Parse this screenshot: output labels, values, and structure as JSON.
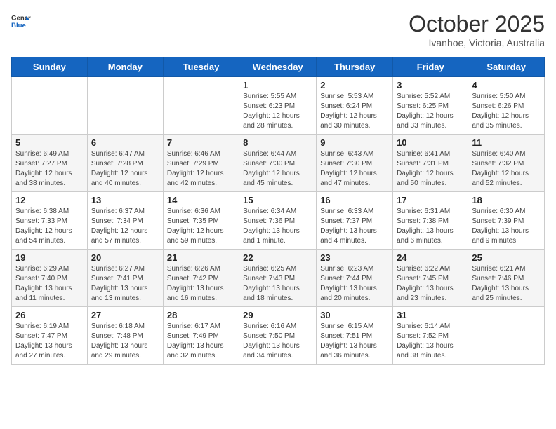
{
  "header": {
    "logo": {
      "general": "General",
      "blue": "Blue"
    },
    "title": "October 2025",
    "location": "Ivanhoe, Victoria, Australia"
  },
  "weekdays": [
    "Sunday",
    "Monday",
    "Tuesday",
    "Wednesday",
    "Thursday",
    "Friday",
    "Saturday"
  ],
  "weeks": [
    [
      {
        "day": "",
        "sunrise": "",
        "sunset": "",
        "daylight": ""
      },
      {
        "day": "",
        "sunrise": "",
        "sunset": "",
        "daylight": ""
      },
      {
        "day": "",
        "sunrise": "",
        "sunset": "",
        "daylight": ""
      },
      {
        "day": "1",
        "sunrise": "Sunrise: 5:55 AM",
        "sunset": "Sunset: 6:23 PM",
        "daylight": "Daylight: 12 hours and 28 minutes."
      },
      {
        "day": "2",
        "sunrise": "Sunrise: 5:53 AM",
        "sunset": "Sunset: 6:24 PM",
        "daylight": "Daylight: 12 hours and 30 minutes."
      },
      {
        "day": "3",
        "sunrise": "Sunrise: 5:52 AM",
        "sunset": "Sunset: 6:25 PM",
        "daylight": "Daylight: 12 hours and 33 minutes."
      },
      {
        "day": "4",
        "sunrise": "Sunrise: 5:50 AM",
        "sunset": "Sunset: 6:26 PM",
        "daylight": "Daylight: 12 hours and 35 minutes."
      }
    ],
    [
      {
        "day": "5",
        "sunrise": "Sunrise: 6:49 AM",
        "sunset": "Sunset: 7:27 PM",
        "daylight": "Daylight: 12 hours and 38 minutes."
      },
      {
        "day": "6",
        "sunrise": "Sunrise: 6:47 AM",
        "sunset": "Sunset: 7:28 PM",
        "daylight": "Daylight: 12 hours and 40 minutes."
      },
      {
        "day": "7",
        "sunrise": "Sunrise: 6:46 AM",
        "sunset": "Sunset: 7:29 PM",
        "daylight": "Daylight: 12 hours and 42 minutes."
      },
      {
        "day": "8",
        "sunrise": "Sunrise: 6:44 AM",
        "sunset": "Sunset: 7:30 PM",
        "daylight": "Daylight: 12 hours and 45 minutes."
      },
      {
        "day": "9",
        "sunrise": "Sunrise: 6:43 AM",
        "sunset": "Sunset: 7:30 PM",
        "daylight": "Daylight: 12 hours and 47 minutes."
      },
      {
        "day": "10",
        "sunrise": "Sunrise: 6:41 AM",
        "sunset": "Sunset: 7:31 PM",
        "daylight": "Daylight: 12 hours and 50 minutes."
      },
      {
        "day": "11",
        "sunrise": "Sunrise: 6:40 AM",
        "sunset": "Sunset: 7:32 PM",
        "daylight": "Daylight: 12 hours and 52 minutes."
      }
    ],
    [
      {
        "day": "12",
        "sunrise": "Sunrise: 6:38 AM",
        "sunset": "Sunset: 7:33 PM",
        "daylight": "Daylight: 12 hours and 54 minutes."
      },
      {
        "day": "13",
        "sunrise": "Sunrise: 6:37 AM",
        "sunset": "Sunset: 7:34 PM",
        "daylight": "Daylight: 12 hours and 57 minutes."
      },
      {
        "day": "14",
        "sunrise": "Sunrise: 6:36 AM",
        "sunset": "Sunset: 7:35 PM",
        "daylight": "Daylight: 12 hours and 59 minutes."
      },
      {
        "day": "15",
        "sunrise": "Sunrise: 6:34 AM",
        "sunset": "Sunset: 7:36 PM",
        "daylight": "Daylight: 13 hours and 1 minute."
      },
      {
        "day": "16",
        "sunrise": "Sunrise: 6:33 AM",
        "sunset": "Sunset: 7:37 PM",
        "daylight": "Daylight: 13 hours and 4 minutes."
      },
      {
        "day": "17",
        "sunrise": "Sunrise: 6:31 AM",
        "sunset": "Sunset: 7:38 PM",
        "daylight": "Daylight: 13 hours and 6 minutes."
      },
      {
        "day": "18",
        "sunrise": "Sunrise: 6:30 AM",
        "sunset": "Sunset: 7:39 PM",
        "daylight": "Daylight: 13 hours and 9 minutes."
      }
    ],
    [
      {
        "day": "19",
        "sunrise": "Sunrise: 6:29 AM",
        "sunset": "Sunset: 7:40 PM",
        "daylight": "Daylight: 13 hours and 11 minutes."
      },
      {
        "day": "20",
        "sunrise": "Sunrise: 6:27 AM",
        "sunset": "Sunset: 7:41 PM",
        "daylight": "Daylight: 13 hours and 13 minutes."
      },
      {
        "day": "21",
        "sunrise": "Sunrise: 6:26 AM",
        "sunset": "Sunset: 7:42 PM",
        "daylight": "Daylight: 13 hours and 16 minutes."
      },
      {
        "day": "22",
        "sunrise": "Sunrise: 6:25 AM",
        "sunset": "Sunset: 7:43 PM",
        "daylight": "Daylight: 13 hours and 18 minutes."
      },
      {
        "day": "23",
        "sunrise": "Sunrise: 6:23 AM",
        "sunset": "Sunset: 7:44 PM",
        "daylight": "Daylight: 13 hours and 20 minutes."
      },
      {
        "day": "24",
        "sunrise": "Sunrise: 6:22 AM",
        "sunset": "Sunset: 7:45 PM",
        "daylight": "Daylight: 13 hours and 23 minutes."
      },
      {
        "day": "25",
        "sunrise": "Sunrise: 6:21 AM",
        "sunset": "Sunset: 7:46 PM",
        "daylight": "Daylight: 13 hours and 25 minutes."
      }
    ],
    [
      {
        "day": "26",
        "sunrise": "Sunrise: 6:19 AM",
        "sunset": "Sunset: 7:47 PM",
        "daylight": "Daylight: 13 hours and 27 minutes."
      },
      {
        "day": "27",
        "sunrise": "Sunrise: 6:18 AM",
        "sunset": "Sunset: 7:48 PM",
        "daylight": "Daylight: 13 hours and 29 minutes."
      },
      {
        "day": "28",
        "sunrise": "Sunrise: 6:17 AM",
        "sunset": "Sunset: 7:49 PM",
        "daylight": "Daylight: 13 hours and 32 minutes."
      },
      {
        "day": "29",
        "sunrise": "Sunrise: 6:16 AM",
        "sunset": "Sunset: 7:50 PM",
        "daylight": "Daylight: 13 hours and 34 minutes."
      },
      {
        "day": "30",
        "sunrise": "Sunrise: 6:15 AM",
        "sunset": "Sunset: 7:51 PM",
        "daylight": "Daylight: 13 hours and 36 minutes."
      },
      {
        "day": "31",
        "sunrise": "Sunrise: 6:14 AM",
        "sunset": "Sunset: 7:52 PM",
        "daylight": "Daylight: 13 hours and 38 minutes."
      },
      {
        "day": "",
        "sunrise": "",
        "sunset": "",
        "daylight": ""
      }
    ]
  ]
}
